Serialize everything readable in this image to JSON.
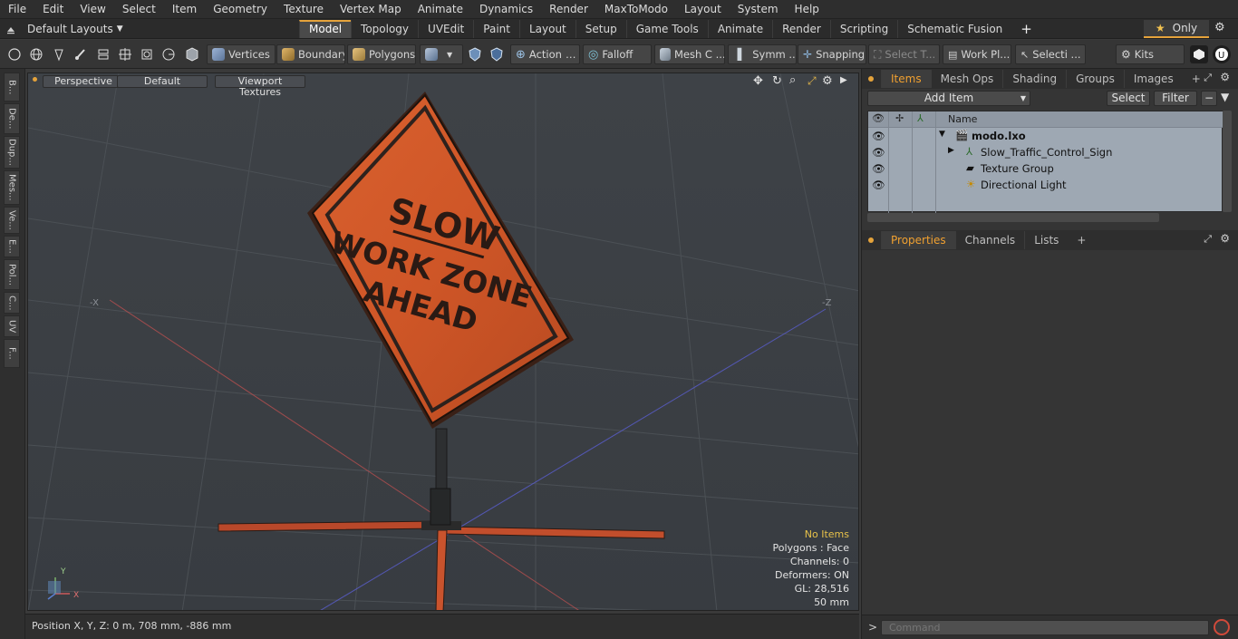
{
  "menubar": {
    "items": [
      "File",
      "Edit",
      "View",
      "Select",
      "Item",
      "Geometry",
      "Texture",
      "Vertex Map",
      "Animate",
      "Dynamics",
      "Render",
      "MaxToModo",
      "Layout",
      "System",
      "Help"
    ]
  },
  "layout_bar": {
    "layout_name": "Default Layouts",
    "tabs": [
      "Model",
      "Topology",
      "UVEdit",
      "Paint",
      "Layout",
      "Setup",
      "Game Tools",
      "Animate",
      "Render",
      "Scripting",
      "Schematic Fusion"
    ],
    "active_tab": "Model",
    "only_label": "Only"
  },
  "toolbar": {
    "vertices": "Vertices",
    "boundary": "Boundary",
    "polygons": "Polygons",
    "action": "Action",
    "falloff": "Falloff",
    "mesh": "Mesh C ...",
    "symm": "Symm ...",
    "snapping": "Snapping",
    "select_t": "Select T...",
    "work_plane": "Work Pl...",
    "selecti": "Selecti ...",
    "kits": "Kits"
  },
  "left_tabs": [
    "B...",
    "De...",
    "Dup...",
    "Mes...",
    "Ve...",
    "E...",
    "Pol...",
    "C...",
    "UV",
    "F..."
  ],
  "viewport": {
    "view_mode": "Perspective",
    "shading": "Default",
    "texture_mode": "Viewport Textures",
    "axis_x_label": "-X",
    "axis_z_label": "-Z",
    "sign_line1": "SLOW",
    "sign_line2": "WORK ZONE",
    "sign_line3": "AHEAD",
    "info": {
      "selection": "No Items",
      "polygons": "Polygons : Face",
      "channels": "Channels: 0",
      "deformers": "Deformers: ON",
      "gl": "GL: 28,516",
      "focal": "50 mm"
    },
    "gizmo_y": "Y",
    "gizmo_x": "X"
  },
  "statusbar": {
    "position": "Position X, Y, Z:   0 m, 708 mm, -886 mm"
  },
  "items_panel": {
    "tabs": [
      "Items",
      "Mesh Ops",
      "Shading",
      "Groups",
      "Images"
    ],
    "active_tab": "Items",
    "add_item": "Add Item",
    "select_btn": "Select",
    "filter_btn": "Filter",
    "column_name": "Name",
    "tree": [
      {
        "label": "modo.lxo",
        "level": 0
      },
      {
        "label": "Slow_Traffic_Control_Sign",
        "level": 1
      },
      {
        "label": "Texture Group",
        "level": 1
      },
      {
        "label": "Directional Light",
        "level": 1
      }
    ]
  },
  "properties_panel": {
    "tabs": [
      "Properties",
      "Channels",
      "Lists"
    ],
    "active_tab": "Properties"
  },
  "command": {
    "placeholder": "Command",
    "prompt": ">"
  },
  "colors": {
    "accent": "#e5a33b",
    "sign_orange": "#d65a2a",
    "viewport_bg": "#3b3f44"
  }
}
